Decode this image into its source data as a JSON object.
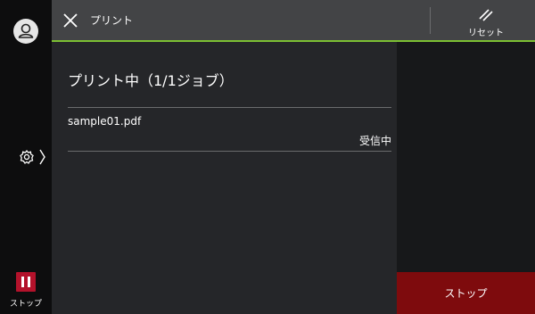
{
  "header": {
    "title": "プリント",
    "reset_label": "リセット"
  },
  "sidebar": {
    "stop_label": "ストップ"
  },
  "main": {
    "heading": "プリント中（1/1ジョブ）",
    "file_name": "sample01.pdf",
    "status": "受信中"
  },
  "footer": {
    "stop_button_label": "ストップ"
  },
  "icons": {
    "user": "user-icon",
    "settings": "gear-icon",
    "stop": "pause-icon",
    "close": "close-icon",
    "reset": "reset-icon"
  },
  "colors": {
    "accent_green": "#7cbf33",
    "stop_red": "#b3122b",
    "stop_button_bg": "#7e0b0d"
  }
}
